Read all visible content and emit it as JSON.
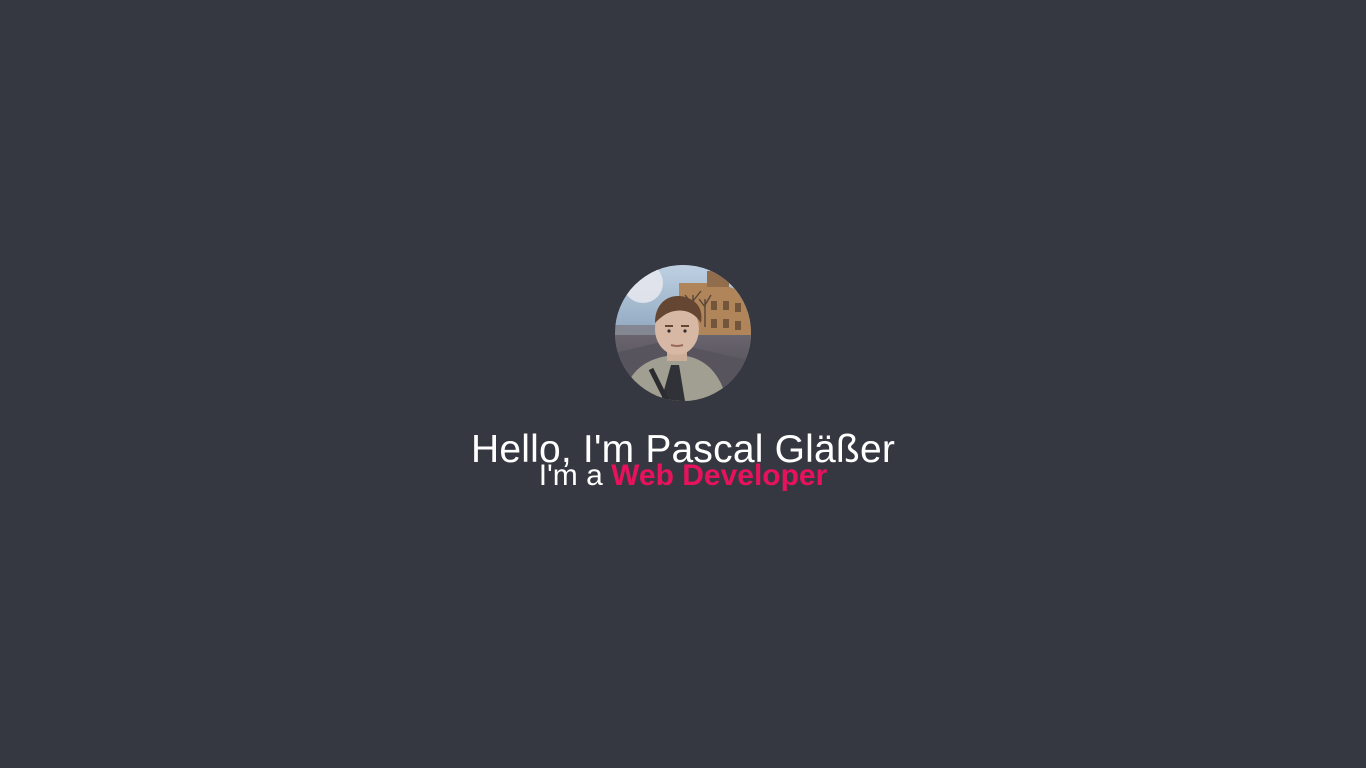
{
  "hero": {
    "avatar_alt": "Profile photo of Pascal Gläßer",
    "greeting": "Hello, I'm Pascal Gläßer",
    "role_prefix": "I'm a ",
    "role_highlight": "Web Developer"
  },
  "colors": {
    "background": "#353841",
    "text": "#ffffff",
    "accent": "#e8125c"
  }
}
